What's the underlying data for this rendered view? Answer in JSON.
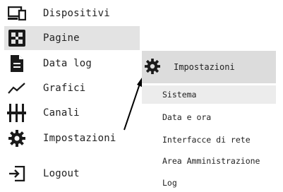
{
  "menu": {
    "items": [
      {
        "label": "Dispositivi",
        "icon": "devices-icon"
      },
      {
        "label": "Pagine",
        "icon": "pages-icon",
        "active": true
      },
      {
        "label": "Data log",
        "icon": "document-icon"
      },
      {
        "label": "Grafici",
        "icon": "chart-line-icon"
      },
      {
        "label": "Canali",
        "icon": "sliders-icon"
      },
      {
        "label": "Impostazioni",
        "icon": "gear-icon"
      },
      {
        "label": "Logout",
        "icon": "logout-icon"
      }
    ]
  },
  "submenu": {
    "title": "Impostazioni",
    "title_icon": "gear-icon",
    "items": [
      {
        "label": "Sistema",
        "highlighted": true
      },
      {
        "label": "Data e ora"
      },
      {
        "label": "Interfacce di rete"
      },
      {
        "label": "Area Amministrazione"
      },
      {
        "label": "Log"
      }
    ]
  },
  "colors": {
    "active_bg": "#e3e3e3",
    "submenu_header_bg": "#dcdcdc",
    "hover_bg": "#ececec",
    "icon": "#1a1a1a"
  }
}
